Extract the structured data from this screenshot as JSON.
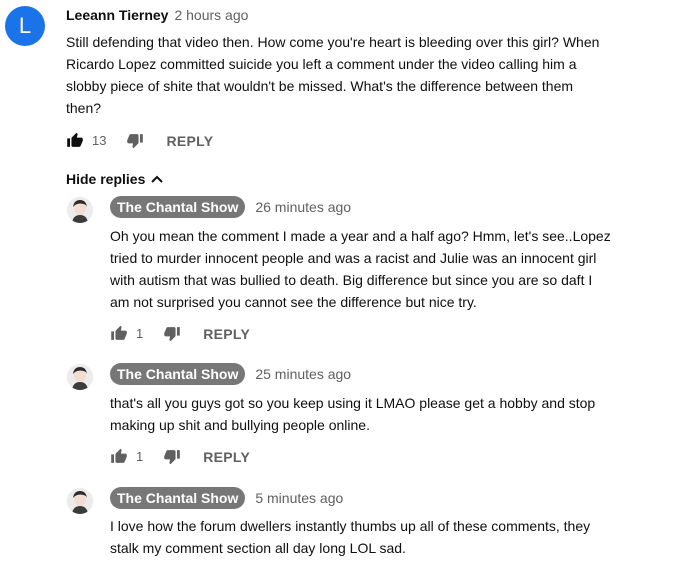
{
  "main_comment": {
    "avatar_letter": "L",
    "author": "Leeann Tierney",
    "time": "2 hours ago",
    "lines": [
      "Still defending that video  then. How come you're  heart is  bleeding over this girl? When",
      "Ricardo  Lopez  committed  suicide  you left a comment under the video calling him a",
      "slobby  piece  of shite  that wouldn't  be missed. What's  the difference between  them",
      "then?"
    ],
    "likes": "13",
    "reply_label": "REPLY"
  },
  "hide_replies_label": "Hide replies",
  "replies": [
    {
      "author": "The Chantal Show",
      "time": "26 minutes ago",
      "lines": [
        "Oh  you mean the comment I made a year and a half ago? Hmm, let's see..Lopez",
        "tried to murder innocent people and was a racist and Julie was an innocent girl",
        "with autism that was bullied to death. Big difference but since you are so daft I",
        "am not surprised you cannot see the difference but nice try."
      ],
      "likes": "1",
      "reply_label": "REPLY"
    },
    {
      "author": "The Chantal Show",
      "time": "25 minutes ago",
      "lines": [
        "that's all you guys got so you keep using it LMAO please get a hobby and stop",
        "making up shit and bullying people online."
      ],
      "likes": "1",
      "reply_label": "REPLY"
    },
    {
      "author": "The Chantal Show",
      "time": "5 minutes ago",
      "lines": [
        "I love how the forum dwellers instantly thumbs up all of these comments, they",
        "stalk my comment section all day long LOL sad."
      ]
    }
  ],
  "colors": {
    "avatar_blue": "#1a73e8",
    "badge_grey": "#777777",
    "muted_text": "#606060"
  }
}
